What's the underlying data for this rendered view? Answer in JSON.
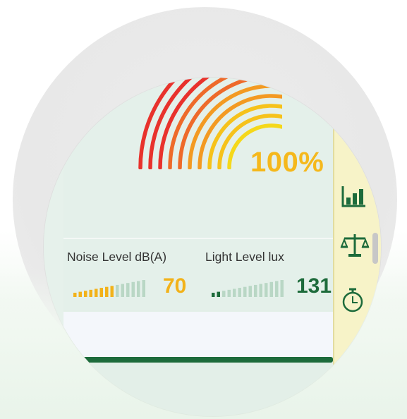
{
  "gauge": {
    "percent_label": "100%",
    "level": 1.0,
    "colors": [
      "#e8322c",
      "#ee6a2a",
      "#f39a22",
      "#f6c21a",
      "#f5d81a"
    ]
  },
  "metrics": {
    "noise": {
      "label": "Noise Level dB(A)",
      "value": "70",
      "color": "#f2b21a",
      "level": 0.58
    },
    "light": {
      "label": "Light Level lux",
      "value": "131",
      "color": "#1d6b3b",
      "level": 0.17
    }
  },
  "side_panel": {
    "icons": [
      "bar-chart-icon",
      "balance-scale-icon",
      "stopwatch-icon"
    ],
    "accent": "#1d6b3b",
    "background": "#f7f3c8"
  }
}
